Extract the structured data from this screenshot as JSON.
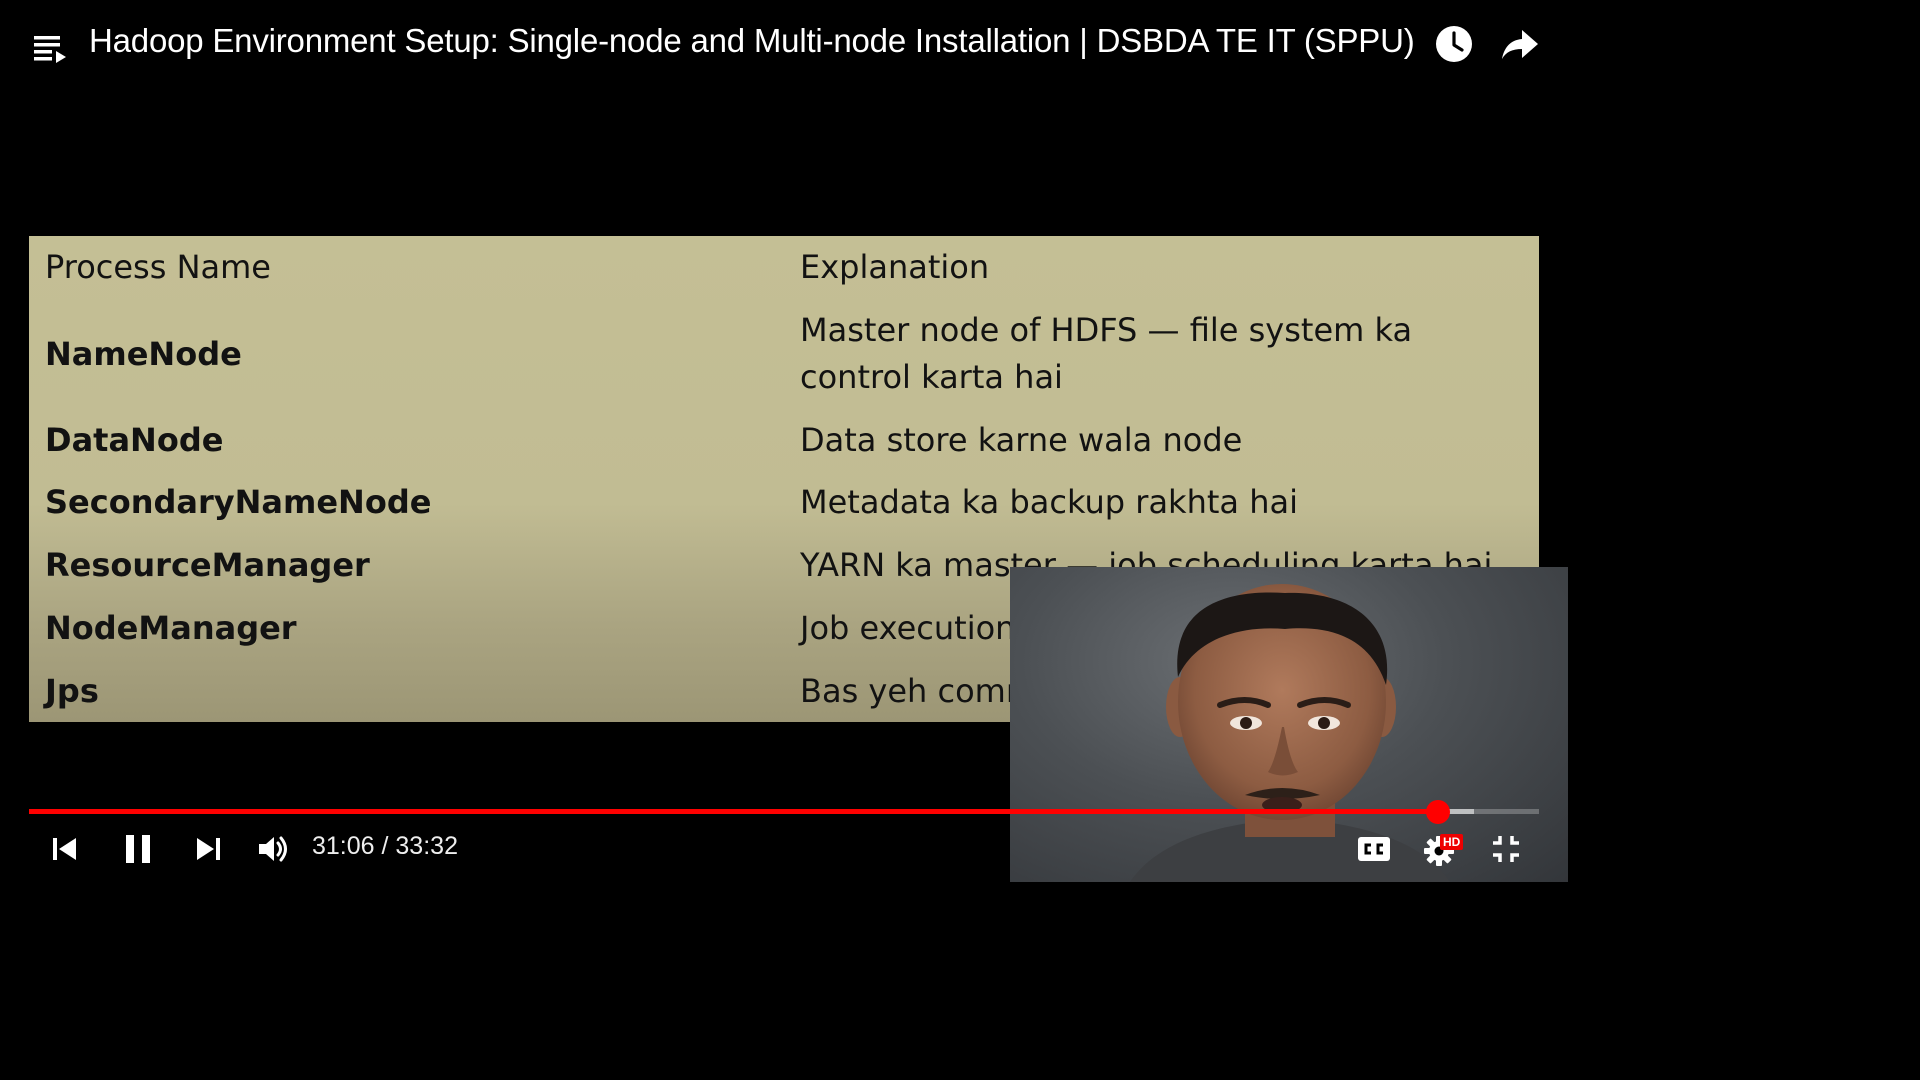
{
  "player": {
    "title": "Hadoop Environment Setup: Single-node and Multi-node Installation | DSBDA TE IT (SPPU)",
    "current_time": "31:06",
    "duration": "33:32",
    "time_separator": " / ",
    "progress_fraction": 0.933,
    "buffer_fraction": 0.957,
    "hd_badge": "HD",
    "accent_color": "#ff0000"
  },
  "slide": {
    "header": {
      "col1": "Process Name",
      "col2": "Explanation"
    },
    "rows": [
      {
        "name": "NameNode",
        "explanation_line1": "Master node of HDFS — file system ka",
        "explanation_line2": "control karta hai"
      },
      {
        "name": "DataNode",
        "explanation": "Data store karne wala node"
      },
      {
        "name": "SecondaryNameNode",
        "explanation": "Metadata ka backup rakhta hai"
      },
      {
        "name": "ResourceManager",
        "explanation": "YARN ka master — job scheduling karta hai"
      },
      {
        "name": "NodeManager",
        "explanation": "Job execution"
      },
      {
        "name": "Jps",
        "explanation": "Bas yeh comm"
      }
    ]
  },
  "icons": {
    "playlist": "playlist-icon",
    "watch_later": "clock-icon",
    "share": "share-icon",
    "previous": "skip-previous-icon",
    "pause": "pause-icon",
    "next": "skip-next-icon",
    "volume": "volume-icon",
    "captions": "captions-icon",
    "settings": "settings-gear-icon",
    "exit_fullscreen": "exit-fullscreen-icon"
  }
}
